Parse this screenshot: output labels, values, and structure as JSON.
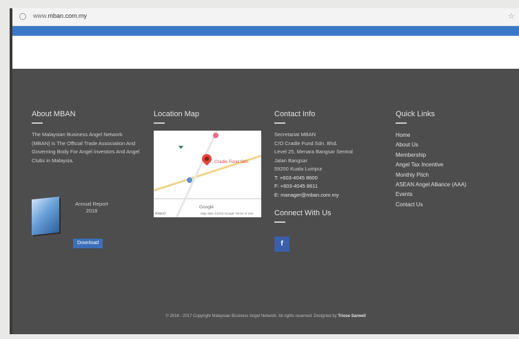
{
  "browser": {
    "url": "mban.com.my",
    "url_prefix": "www."
  },
  "about": {
    "title": "About MBAN",
    "text": "The Malaysian Business Angel Network (MBAN) is The Official Trade Association And Governing Body For Angel Investors And Angel Clubs in Malaysia.",
    "report_text": "Annual Report 2018",
    "download_label": "Download"
  },
  "location": {
    "title": "Location Map",
    "place_label": "Cradle Fund Sdn",
    "google_label": "Google",
    "map_data_label": "Map data ©2019 Google",
    "terms_label": "Terms of Use",
    "report_label": "Report"
  },
  "contact": {
    "title": "Contact Info",
    "lines": [
      "Secretariat MBAN",
      "C/O Cradle Fund Sdn. Bhd.",
      "Level 25, Menara Bangsar Sentral",
      "Jalan Bangsar",
      "59200 Kuala Lumpur",
      "T: +603-4045 8600",
      "F: +603-4045 8611",
      "E: manager@mban.com.my"
    ],
    "connect_title": "Connect With Us",
    "facebook_glyph": "f"
  },
  "quick_links": {
    "title": "Quick Links",
    "items": [
      "Home",
      "About Us",
      "Membership",
      "Angel Tax Incentive",
      "Monthly Pitch",
      "ASEAN Angel Alliance (AAA)",
      "Events",
      "Contact Us"
    ]
  },
  "footer": {
    "copyright": "© 2016 - 2017 Copyright Malaysian Business Angel Network. All rights reserved. Designed by",
    "designer": "Triose Sarwell"
  }
}
